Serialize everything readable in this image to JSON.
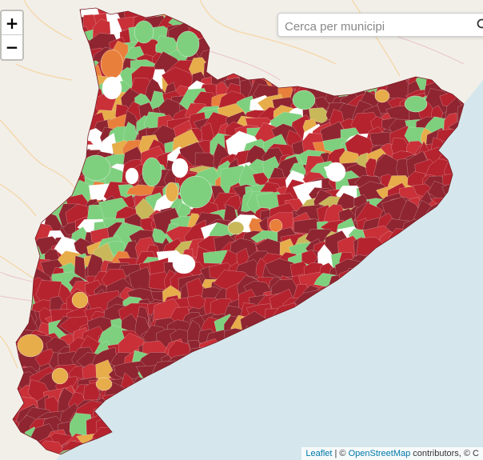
{
  "map": {
    "colors": {
      "sea": "#d5e7ec",
      "land_background": "#f2efe9",
      "border_lines": "#e8b9c6",
      "dark_red": "#8f2530",
      "red": "#b5232e",
      "bright_red": "#c93038",
      "orange": "#e8803c",
      "yellow": "#e6ad4a",
      "olive": "#c9b85a",
      "green": "#7ed07e",
      "white": "#ffffff"
    },
    "region": "Catalunya"
  },
  "zoom": {
    "in_label": "+",
    "out_label": "−"
  },
  "search": {
    "placeholder": "Cerca per municipi",
    "icon": "search-icon"
  },
  "attribution": {
    "leaflet": "Leaflet",
    "separator": " | © ",
    "osm": "OpenStreetMap",
    "contributors": " contributors, © C"
  }
}
